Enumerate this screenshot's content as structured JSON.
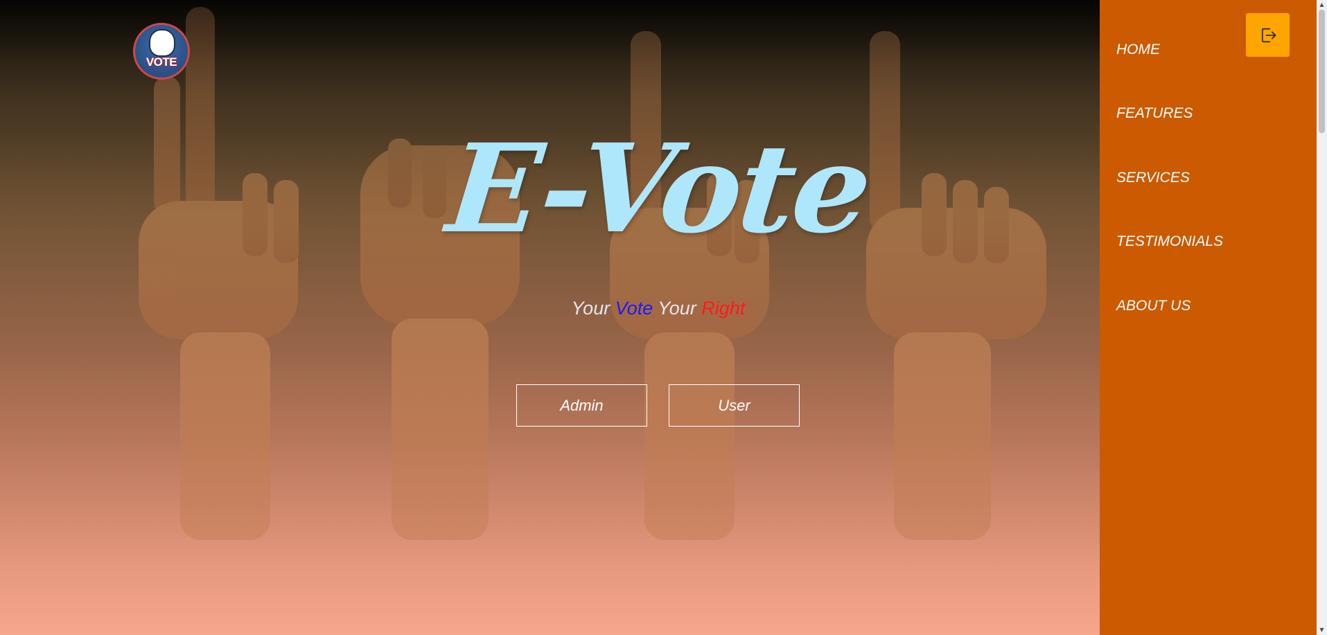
{
  "hero": {
    "logo_text": "VOTE",
    "title": "E-Vote",
    "tagline": {
      "part1": "Your ",
      "part2": "Vote",
      "part3": " Your ",
      "part4": "Right"
    },
    "buttons": {
      "admin_label": "Admin",
      "user_label": "User"
    }
  },
  "sidebar": {
    "items": [
      {
        "label": "HOME"
      },
      {
        "label": "FEATURES"
      },
      {
        "label": "SERVICES"
      },
      {
        "label": "TESTIMONIALS"
      },
      {
        "label": "ABOUT US"
      }
    ],
    "logout_icon": "logout-icon"
  },
  "colors": {
    "sidebar_bg": "#cc5a00",
    "logout_bg": "#ffa500",
    "title_color": "#aee7fb",
    "tagline_blue": "#1a1aff",
    "tagline_red": "#ff1a1a"
  }
}
